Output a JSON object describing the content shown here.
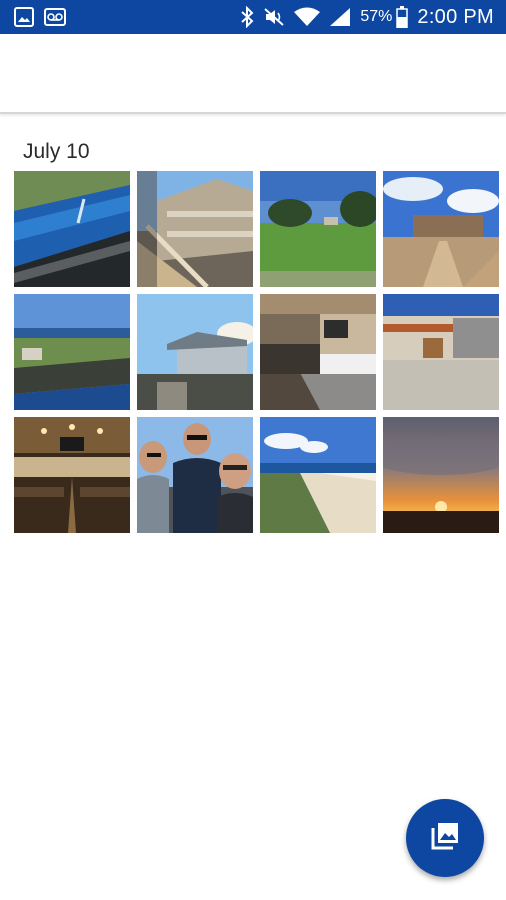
{
  "status_bar": {
    "icons": [
      "gallery-icon",
      "voicemail-icon",
      "bluetooth-icon",
      "muted-icon",
      "wifi-icon",
      "cellular-signal-icon",
      "battery-icon"
    ],
    "battery": "57%",
    "time": "2:00 PM"
  },
  "gallery": {
    "sections": [
      {
        "date": "July 10",
        "photos": [
          "pool-aerial-photo",
          "beach-house-deck-photo",
          "lawn-trees-photo",
          "boardwalk-house-photo",
          "ocean-view-from-roof-photo",
          "rooftop-view-houses-photo",
          "outdoor-kitchen-bar-photo",
          "parking-lot-house-photo",
          "dining-hall-photo",
          "three-men-selfie-photo",
          "beach-dunes-photo",
          "sunset-photo"
        ]
      }
    ]
  },
  "fab": {
    "icon": "photo-library-icon"
  },
  "colors": {
    "primary": "#0d47a1",
    "background": "#ffffff"
  }
}
